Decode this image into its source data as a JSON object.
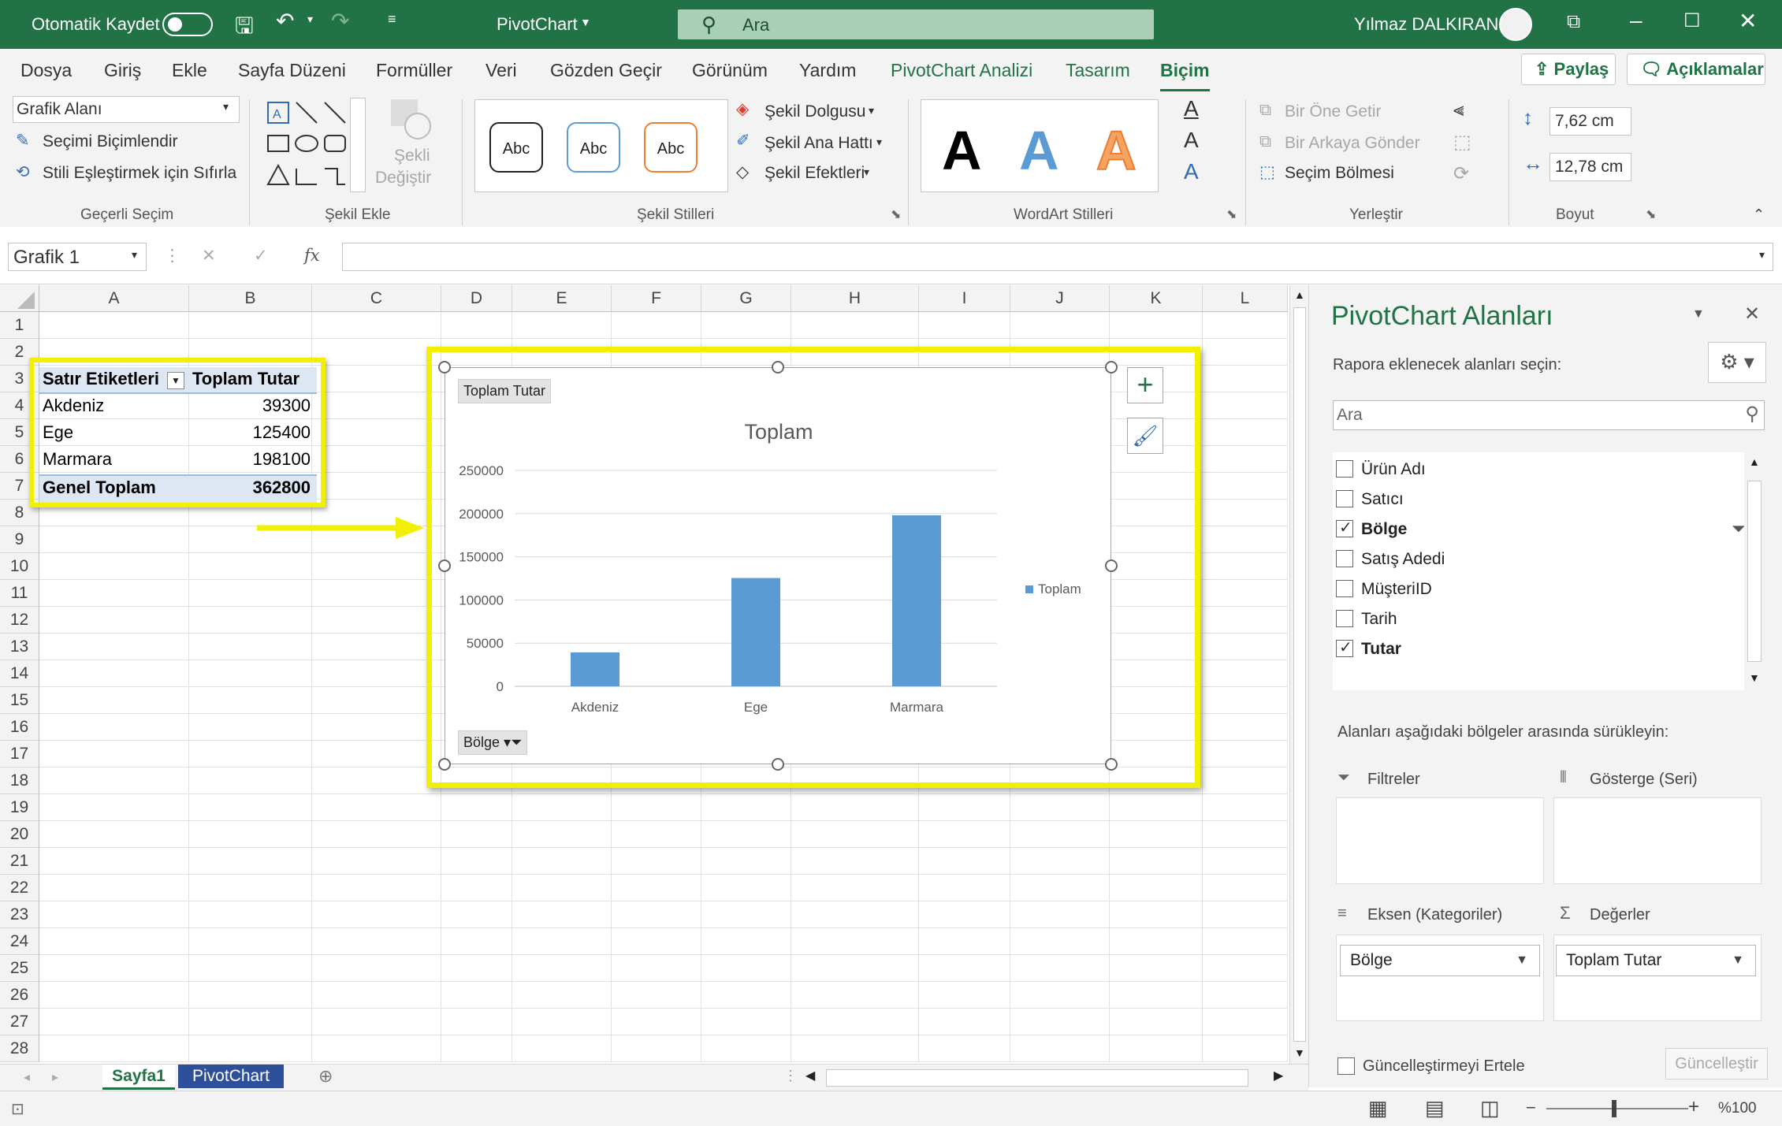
{
  "titlebar": {
    "autosave_label": "Otomatik Kaydet",
    "doc_title": "PivotChart",
    "search_placeholder": "Ara",
    "user_name": "Yılmaz DALKIRAN"
  },
  "tabs": [
    "Dosya",
    "Giriş",
    "Ekle",
    "Sayfa Düzeni",
    "Formüller",
    "Veri",
    "Gözden Geçir",
    "Görünüm",
    "Yardım",
    "PivotChart Analizi",
    "Tasarım",
    "Biçim"
  ],
  "tab_buttons": {
    "share": "Paylaş",
    "comments": "Açıklamalar"
  },
  "ribbon": {
    "current_selection": {
      "dropdown": "Grafik Alanı",
      "format_selection": "Seçimi Biçimlendir",
      "reset_style": "Stili Eşleştirmek için Sıfırla",
      "label": "Geçerli Seçim"
    },
    "insert_shapes": {
      "change_shape_1": "Şekli",
      "change_shape_2": "Değiştir",
      "label": "Şekil Ekle"
    },
    "shape_styles": {
      "samples": [
        "Abc",
        "Abc",
        "Abc"
      ],
      "fill": "Şekil Dolgusu",
      "outline": "Şekil Ana Hattı",
      "effects": "Şekil Efektleri",
      "label": "Şekil Stilleri"
    },
    "wordart": {
      "samples": [
        "A",
        "A",
        "A"
      ],
      "label": "WordArt Stilleri"
    },
    "arrange": {
      "bring_forward": "Bir Öne Getir",
      "send_backward": "Bir Arkaya Gönder",
      "selection_pane": "Seçim Bölmesi",
      "label": "Yerleştir"
    },
    "size": {
      "height": "7,62 cm",
      "width": "12,78 cm",
      "label": "Boyut"
    }
  },
  "formula_bar": {
    "name_box": "Grafik 1",
    "fx": "fx"
  },
  "columns": [
    "A",
    "B",
    "C",
    "D",
    "E",
    "F",
    "G",
    "H",
    "I",
    "J",
    "K",
    "L"
  ],
  "rows": [
    "1",
    "2",
    "3",
    "4",
    "5",
    "6",
    "7",
    "8",
    "9",
    "10",
    "11",
    "12",
    "13",
    "14",
    "15",
    "16",
    "17",
    "18",
    "19",
    "20",
    "21",
    "22",
    "23",
    "24",
    "25",
    "26",
    "27",
    "28"
  ],
  "pivot_table": {
    "header_rows": "Satır Etiketleri",
    "header_values": "Toplam Tutar",
    "rows": [
      {
        "label": "Akdeniz",
        "value": "39300"
      },
      {
        "label": "Ege",
        "value": "125400"
      },
      {
        "label": "Marmara",
        "value": "198100"
      }
    ],
    "total_label": "Genel Toplam",
    "total_value": "362800"
  },
  "chart_data": {
    "type": "bar",
    "title": "Toplam",
    "categories": [
      "Akdeniz",
      "Ege",
      "Marmara"
    ],
    "series": [
      {
        "name": "Toplam",
        "values": [
          39300,
          125400,
          198100
        ]
      }
    ],
    "ylim": [
      0,
      250000
    ],
    "yticks": [
      "250000",
      "200000",
      "150000",
      "100000",
      "50000",
      "0"
    ],
    "value_field_button": "Toplam Tutar",
    "axis_field_button": "Bölge",
    "legend_position": "right",
    "grid": true,
    "bar_color": "#5b9bd5"
  },
  "pane": {
    "title": "PivotChart Alanları",
    "subtitle": "Rapora eklenecek alanları seçin:",
    "search_placeholder": "Ara",
    "fields": [
      {
        "name": "Ürün Adı",
        "checked": false
      },
      {
        "name": "Satıcı",
        "checked": false
      },
      {
        "name": "Bölge",
        "checked": true
      },
      {
        "name": "Satış Adedi",
        "checked": false
      },
      {
        "name": "MüşteriID",
        "checked": false
      },
      {
        "name": "Tarih",
        "checked": false
      },
      {
        "name": "Tutar",
        "checked": true
      }
    ],
    "drag_hint": "Alanları aşağıdaki bölgeler arasında sürükleyin:",
    "areas": {
      "filters": "Filtreler",
      "legend": "Gösterge (Seri)",
      "axis": "Eksen (Kategoriler)",
      "values": "Değerler"
    },
    "axis_item": "Bölge",
    "values_item": "Toplam Tutar",
    "defer_label": "Güncelleştirmeyi Ertele",
    "update_button": "Güncelleştir"
  },
  "sheets": [
    "Sayfa1",
    "PivotChart"
  ],
  "status": {
    "zoom": "%100"
  }
}
